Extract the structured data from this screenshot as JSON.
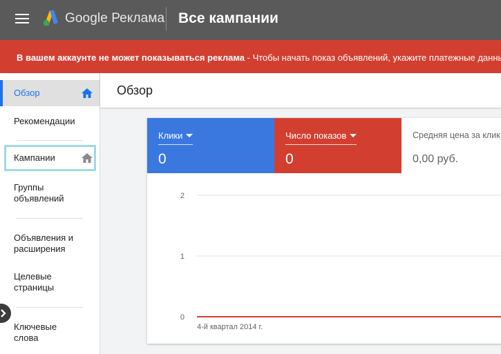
{
  "header": {
    "brand": "Google Реклама",
    "page_title": "Все кампании"
  },
  "alert": {
    "bold_text": "В вашем аккаунте не может показываться реклама",
    "text": " - Чтобы начать показ объявлений, укажите платежные данные"
  },
  "sidebar": {
    "items": [
      {
        "label": "Обзор"
      },
      {
        "label": "Рекомендации"
      },
      {
        "label": "Кампании"
      },
      {
        "label": "Группы объявлений"
      },
      {
        "label": "Объявления и расширения"
      },
      {
        "label": "Целевые страницы"
      },
      {
        "label": "Ключевые слова"
      }
    ]
  },
  "main": {
    "title": "Обзор"
  },
  "metrics": [
    {
      "label": "Клики",
      "value": "0"
    },
    {
      "label": "Число показов",
      "value": "0"
    },
    {
      "label": "Средняя цена за клик",
      "value": "0,00 руб."
    }
  ],
  "colors": {
    "clicks": "#3a78e0",
    "impressions": "#d23f31",
    "header": "#5a5a5a",
    "alert": "#d23f31",
    "active_nav": "#1a73e8"
  },
  "chart_data": {
    "type": "line",
    "x": [
      "4-й квартал 2014 г."
    ],
    "series": [
      {
        "values": [
          0,
          0
        ]
      }
    ],
    "y_ticks": [
      0,
      1,
      2
    ],
    "ylim": [
      0,
      2
    ],
    "x_label_text": "4-й квартал 2014 г.",
    "grid": true
  }
}
